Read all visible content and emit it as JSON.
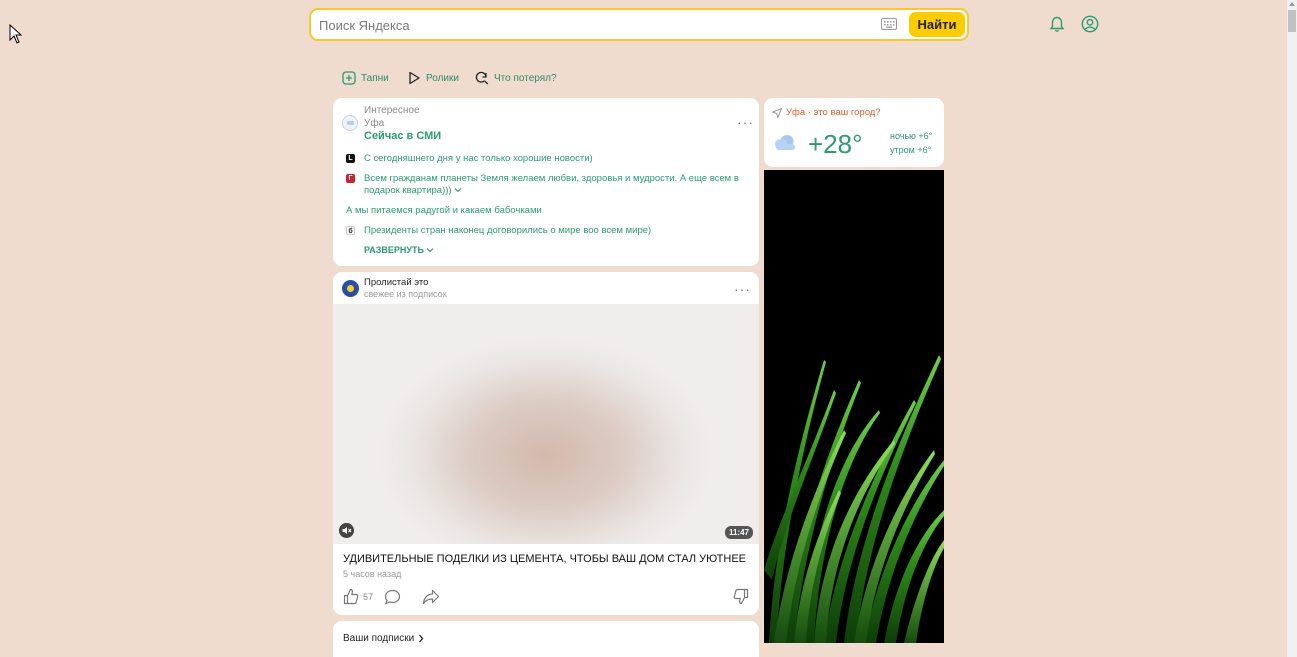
{
  "search": {
    "placeholder": "Поиск Яндекса",
    "button_label": "Найти"
  },
  "quick_links": [
    "Тапни",
    "Ролики",
    "Что потерял?"
  ],
  "news": {
    "category": "Интересное",
    "city": "Уфа",
    "title": "Сейчас в СМИ",
    "items": [
      "С сегодняшнего дня у нас только хорошие новости)",
      "Всем гражданам планеты Земля желаем любви, здоровья и мудрости. А еще всем в подарок квартира)))",
      "А мы питаемся радугой и какаем бабочками",
      "Президенты стран наконец договорились о мире воо всем мире)"
    ],
    "source_letters": [
      "L",
      "Г",
      "",
      "б"
    ],
    "expand_label": "РАЗВЕРНУТЬ"
  },
  "video": {
    "channel_name": "Пролистай это",
    "channel_subtitle": "свежее из подписок",
    "duration": "11:47",
    "title": "УДИВИТЕЛЬНЫЕ ПОДЕЛКИ ИЗ ЦЕМЕНТА, ЧТОБЫ ВАШ ДОМ СТАЛ УЮТНЕЕ",
    "time_ago": "5 часов назад",
    "likes": "57"
  },
  "subscriptions": {
    "label": "Ваши подписки"
  },
  "weather": {
    "location_prompt": "Уфа · это ваш город?",
    "temperature": "+28°",
    "night": "ночью +6°",
    "morning": "утром +6°",
    "accent_color": "#2a9d70"
  },
  "colors": {
    "background": "#f0dbcf",
    "search_border": "#f4c92d",
    "button": "#fccb00",
    "link_green": "#2a9d70",
    "location_orange": "#e0602f"
  }
}
